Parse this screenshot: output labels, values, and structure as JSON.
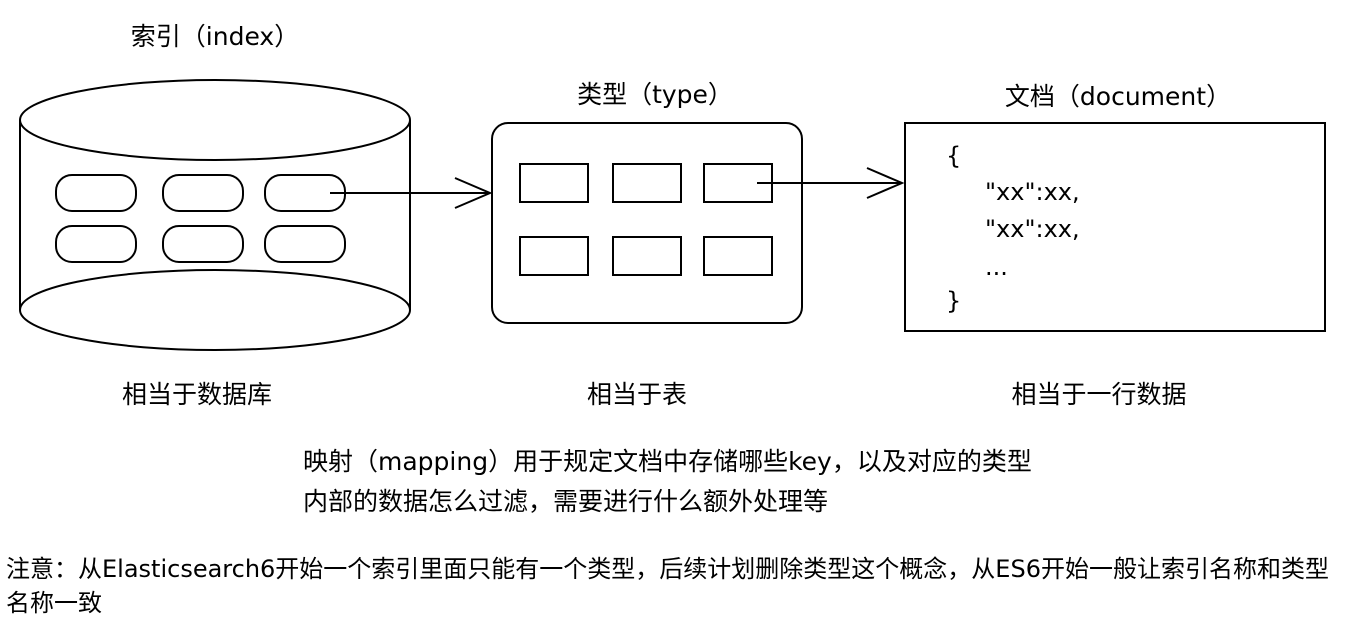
{
  "index": {
    "title": "索引（index）",
    "caption": "相当于数据库"
  },
  "type": {
    "title": "类型（type）",
    "caption": "相当于表"
  },
  "document": {
    "title": "文档（document）",
    "caption": "相当于一行数据",
    "lines": [
      "{",
      "\"xx\":xx,",
      "\"xx\":xx,",
      "...",
      "}"
    ]
  },
  "mapping": {
    "line1": "映射（mapping）用于规定文档中存储哪些key，以及对应的类型",
    "line2": "内部的数据怎么过滤，需要进行什么额外处理等"
  },
  "note": {
    "text": "注意：从Elasticsearch6开始一个索引里面只能有一个类型，后续计划删除类型这个概念，从ES6开始一般让索引名称和类型名称一致"
  }
}
